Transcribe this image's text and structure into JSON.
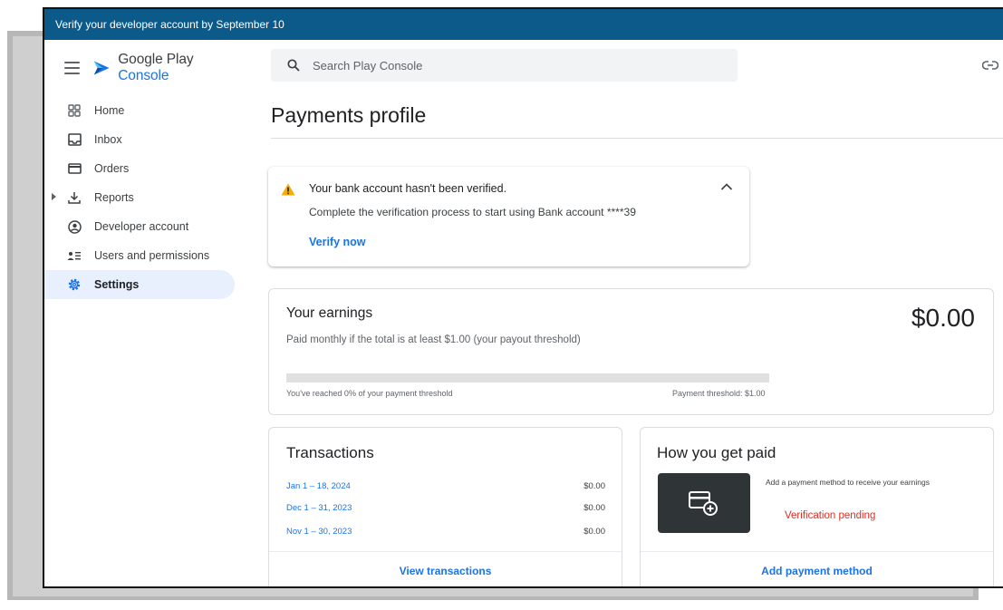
{
  "banner": {
    "text": "Verify your developer account by September 10"
  },
  "brand": {
    "name": "Google Play",
    "product": "Console"
  },
  "search": {
    "placeholder": "Search Play Console"
  },
  "sidebar": {
    "items": [
      {
        "label": "Home",
        "icon": "home-grid-icon"
      },
      {
        "label": "Inbox",
        "icon": "inbox-icon"
      },
      {
        "label": "Orders",
        "icon": "card-icon"
      },
      {
        "label": "Reports",
        "icon": "download-icon"
      },
      {
        "label": "Developer account",
        "icon": "account-circle-icon"
      },
      {
        "label": "Users and permissions",
        "icon": "people-list-icon"
      },
      {
        "label": "Settings",
        "icon": "gear-icon"
      }
    ],
    "active": "Settings"
  },
  "page": {
    "title": "Payments profile"
  },
  "alert": {
    "title": "Your bank account hasn't been verified.",
    "body": "Complete the verification process to start using Bank account ****39",
    "action": "Verify now"
  },
  "earnings": {
    "title": "Your earnings",
    "subtitle": "Paid monthly if the total is at least $1.00 (your payout threshold)",
    "amount": "$0.00",
    "progress_percent": 0,
    "progress_label": "You've reached 0% of your payment threshold",
    "threshold_label": "Payment threshold: $1.00"
  },
  "transactions": {
    "title": "Transactions",
    "rows": [
      {
        "period": "Jan 1 – 18, 2024",
        "amount": "$0.00"
      },
      {
        "period": "Dec 1 – 31, 2023",
        "amount": "$0.00"
      },
      {
        "period": "Nov 1 – 30, 2023",
        "amount": "$0.00"
      }
    ],
    "action": "View transactions"
  },
  "payment": {
    "title": "How you get paid",
    "hint": "Add a payment method to receive your earnings",
    "status": "Verification pending",
    "action": "Add payment method"
  },
  "colors": {
    "banner": "#0b5a8a",
    "accent": "#1a73e8",
    "warning": "#f9ab00",
    "error": "#d93025",
    "active_nav": "#e8f0fe"
  }
}
